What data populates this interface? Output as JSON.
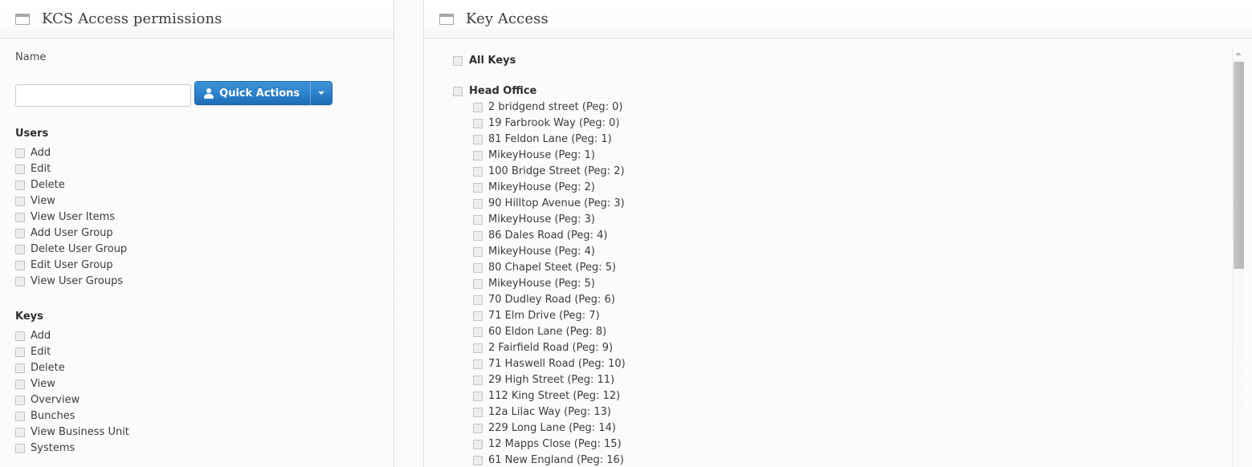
{
  "left_panel": {
    "icon": "window-icon",
    "title": "KCS Access permissions",
    "name_label": "Name",
    "name_value": "",
    "name_placeholder": "",
    "quick_actions": {
      "label": "Quick Actions",
      "icon": "user-icon",
      "caret_icon": "chevron-down-icon"
    },
    "sections": [
      {
        "title": "Users",
        "items": [
          "Add",
          "Edit",
          "Delete",
          "View",
          "View User Items",
          "Add User Group",
          "Delete User Group",
          "Edit User Group",
          "View User Groups"
        ]
      },
      {
        "title": "Keys",
        "items": [
          "Add",
          "Edit",
          "Delete",
          "View",
          "Overview",
          "Bunches",
          "View Business Unit",
          "Systems"
        ]
      }
    ]
  },
  "right_panel": {
    "icon": "window-icon",
    "title": "Key Access",
    "all_keys_label": "All Keys",
    "group_label": "Head Office",
    "keys": [
      "2 bridgend street (Peg: 0)",
      "19 Farbrook Way (Peg: 0)",
      "81 Feldon Lane (Peg: 1)",
      "MikeyHouse (Peg: 1)",
      "100 Bridge Street (Peg: 2)",
      "MikeyHouse (Peg: 2)",
      "90 Hilltop Avenue (Peg: 3)",
      "MikeyHouse (Peg: 3)",
      "86 Dales Road (Peg: 4)",
      "MikeyHouse (Peg: 4)",
      "80 Chapel Steet (Peg: 5)",
      "MikeyHouse (Peg: 5)",
      "70 Dudley Road (Peg: 6)",
      "71 Elm Drive (Peg: 7)",
      "60 Eldon Lane (Peg: 8)",
      "2 Fairfield Road (Peg: 9)",
      "71 Haswell Road (Peg: 10)",
      "29 High Street (Peg: 11)",
      "112 King Street (Peg: 12)",
      "12a Lilac Way (Peg: 13)",
      "229 Long Lane (Peg: 14)",
      "12 Mapps Close (Peg: 15)",
      "61 New England (Peg: 16)"
    ],
    "scrollbar": {
      "up_arrow_icon": "chevron-up-icon"
    }
  },
  "colors": {
    "primary_button": "#2f86cf",
    "primary_button_border": "#1d63a6",
    "panel_border": "#dddddd",
    "text": "#3c3c3c",
    "heading": "#2e2e2e"
  }
}
